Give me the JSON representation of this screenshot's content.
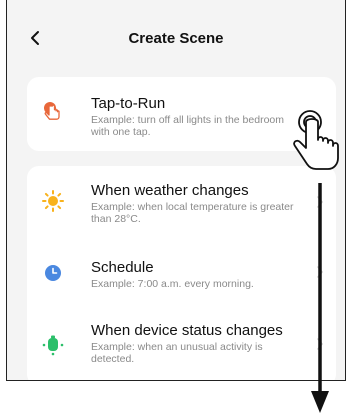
{
  "header": {
    "title": "Create Scene"
  },
  "tap_to_run": {
    "title": "Tap-to-Run",
    "description": "Example: turn off all lights in the bedroom with one tap.",
    "icon": "tap-hand-icon"
  },
  "conditions": [
    {
      "title": "When weather changes",
      "description": "Example: when local temperature is greater than 28°C.",
      "icon": "sun-icon"
    },
    {
      "title": "Schedule",
      "description": "Example: 7:00 a.m. every morning.",
      "icon": "clock-icon"
    },
    {
      "title": "When device status changes",
      "description": "Example: when an unusual activity is detected.",
      "icon": "device-icon"
    }
  ],
  "colors": {
    "tap_icon": "#e8673a",
    "sun": "#f8b21c",
    "clock": "#4a88e0",
    "device": "#2bbf6a"
  }
}
